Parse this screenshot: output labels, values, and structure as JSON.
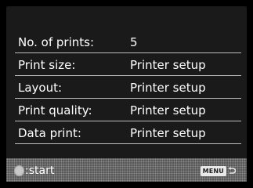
{
  "settings": {
    "rows": [
      {
        "label": "No. of prints:",
        "value": "5"
      },
      {
        "label": "Print size:",
        "value": "Printer setup"
      },
      {
        "label": "Layout:",
        "value": "Printer setup"
      },
      {
        "label": "Print quality:",
        "value": "Printer setup"
      },
      {
        "label": "Data print:",
        "value": "Printer setup"
      }
    ]
  },
  "footer": {
    "start_label": ":start",
    "start_icon": "oval-button-icon",
    "menu_label": "MENU",
    "back_icon": "return-arrow-icon"
  },
  "colors": {
    "background": "#000000",
    "panel": "#1a1a1a",
    "divider": "#bdbdbd",
    "text": "#ffffff",
    "footer_bg": "#686868"
  }
}
